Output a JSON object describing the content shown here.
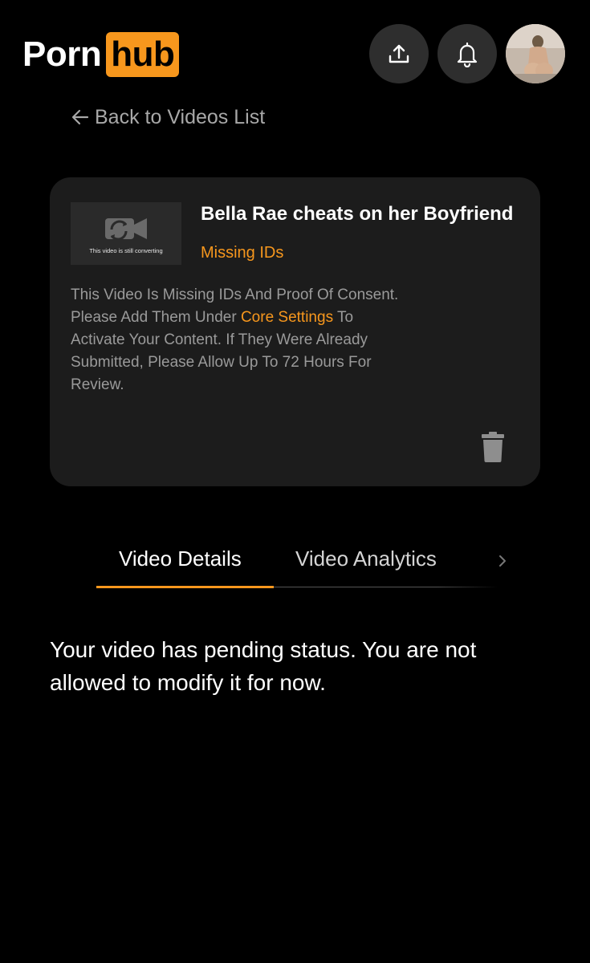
{
  "header": {
    "logo_part1": "Porn",
    "logo_part2": "hub",
    "upload_icon": "upload-icon",
    "notifications_icon": "bell-icon",
    "avatar_icon": "user-avatar"
  },
  "colors": {
    "accent": "#f7971d",
    "background": "#000000",
    "card": "#1c1c1c",
    "icon_button": "#2e2e2e"
  },
  "back_link": {
    "label": "Back to Videos List",
    "icon": "arrow-left-icon"
  },
  "video_card": {
    "thumbnail_caption": "This video is still converting",
    "title": "Bella Rae cheats on her Boyfriend",
    "status": "Missing IDs",
    "notice_part1": "This Video Is Missing IDs And Proof Of Consent. Please Add Them Under ",
    "notice_link": "Core Settings",
    "notice_part2": " To Activate Your Content. If They Were Already Submitted, Please Allow Up To 72 Hours For Review.",
    "delete_icon": "trash-icon"
  },
  "tabs": {
    "items": [
      {
        "label": "Video Details",
        "active": true
      },
      {
        "label": "Video Analytics",
        "active": false
      }
    ],
    "next_icon": "chevron-right-icon"
  },
  "main": {
    "pending_message": "Your video has pending status. You are not allowed to modify it for now."
  }
}
